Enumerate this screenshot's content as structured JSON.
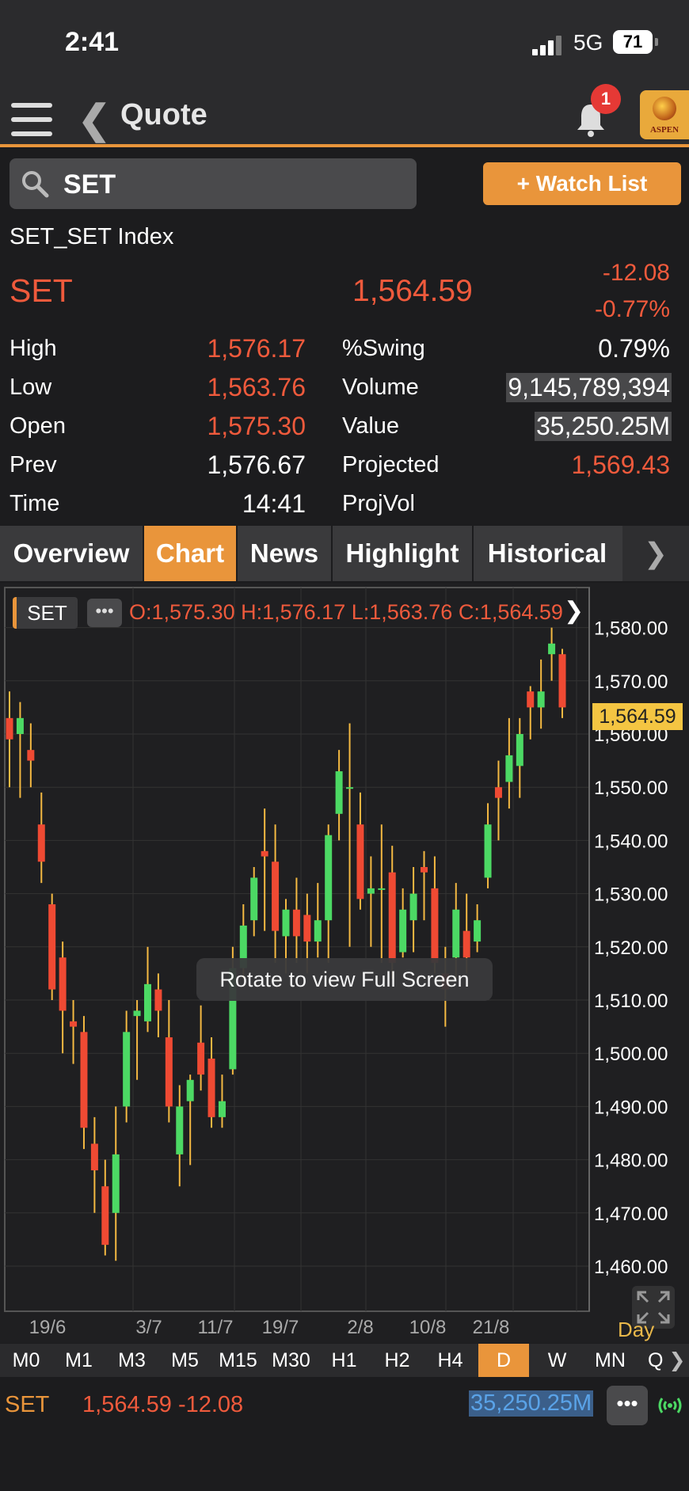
{
  "status": {
    "time": "2:41",
    "network": "5G",
    "battery": "71"
  },
  "header": {
    "title": "Quote",
    "badge": "1",
    "logo_text": "ASPEN"
  },
  "search": {
    "value": "SET",
    "watchlist_label": "+ Watch List"
  },
  "quote": {
    "index_name": "SET_SET Index",
    "symbol": "SET",
    "price": "1,564.59",
    "change": "-12.08",
    "change_pct": "-0.77%"
  },
  "stats": {
    "high_label": "High",
    "high": "1,576.17",
    "low_label": "Low",
    "low": "1,563.76",
    "open_label": "Open",
    "open": "1,575.30",
    "prev_label": "Prev",
    "prev": "1,576.67",
    "time_label": "Time",
    "time": "14:41",
    "swing_label": "%Swing",
    "swing": "0.79%",
    "volume_label": "Volume",
    "volume": "9,145,789,394",
    "value_label": "Value",
    "value": "35,250.25M",
    "projected_label": "Projected",
    "projected": "1,569.43",
    "projvol_label": "ProjVol"
  },
  "tabs": [
    "Overview",
    "Chart",
    "News",
    "Highlight",
    "Historical"
  ],
  "active_tab": "Chart",
  "chart_toolbar": {
    "symbol": "SET",
    "ohlc": "O:1,575.30  H:1,576.17  L:1,563.76  C:1,564.59",
    "rotate_hint": "Rotate to view Full Screen",
    "last_price": "1,564.59",
    "period": "Day"
  },
  "chart_data": {
    "type": "candlestick",
    "y_ticks": [
      "1,580.00",
      "1,570.00",
      "1,560.00",
      "1,550.00",
      "1,540.00",
      "1,530.00",
      "1,520.00",
      "1,510.00",
      "1,500.00",
      "1,490.00",
      "1,480.00",
      "1,470.00",
      "1,460.00"
    ],
    "x_ticks": [
      "19/6",
      "3/7",
      "11/7",
      "19/7",
      "2/8",
      "10/8",
      "21/8"
    ],
    "ylim": [
      1455,
      1587
    ],
    "up_color": "#4cd964",
    "down_color": "#ef4a33",
    "candles": [
      {
        "o": 1563,
        "h": 1568,
        "l": 1550,
        "c": 1559
      },
      {
        "o": 1560,
        "h": 1566,
        "l": 1548,
        "c": 1563
      },
      {
        "o": 1557,
        "h": 1562,
        "l": 1550,
        "c": 1555
      },
      {
        "o": 1543,
        "h": 1549,
        "l": 1532,
        "c": 1536
      },
      {
        "o": 1528,
        "h": 1530,
        "l": 1510,
        "c": 1512
      },
      {
        "o": 1518,
        "h": 1521,
        "l": 1500,
        "c": 1508
      },
      {
        "o": 1506,
        "h": 1510,
        "l": 1498,
        "c": 1505
      },
      {
        "o": 1504,
        "h": 1507,
        "l": 1482,
        "c": 1486
      },
      {
        "o": 1483,
        "h": 1488,
        "l": 1470,
        "c": 1478
      },
      {
        "o": 1475,
        "h": 1480,
        "l": 1462,
        "c": 1464
      },
      {
        "o": 1470,
        "h": 1490,
        "l": 1461,
        "c": 1481
      },
      {
        "o": 1490,
        "h": 1508,
        "l": 1487,
        "c": 1504
      },
      {
        "o": 1507,
        "h": 1510,
        "l": 1495,
        "c": 1508
      },
      {
        "o": 1506,
        "h": 1520,
        "l": 1504,
        "c": 1513
      },
      {
        "o": 1512,
        "h": 1515,
        "l": 1503,
        "c": 1508
      },
      {
        "o": 1503,
        "h": 1510,
        "l": 1487,
        "c": 1490
      },
      {
        "o": 1481,
        "h": 1494,
        "l": 1475,
        "c": 1490
      },
      {
        "o": 1491,
        "h": 1496,
        "l": 1479,
        "c": 1495
      },
      {
        "o": 1502,
        "h": 1509,
        "l": 1493,
        "c": 1496
      },
      {
        "o": 1499,
        "h": 1503,
        "l": 1486,
        "c": 1488
      },
      {
        "o": 1488,
        "h": 1496,
        "l": 1486,
        "c": 1491
      },
      {
        "o": 1497,
        "h": 1520,
        "l": 1496,
        "c": 1516
      },
      {
        "o": 1516,
        "h": 1528,
        "l": 1514,
        "c": 1524
      },
      {
        "o": 1525,
        "h": 1535,
        "l": 1522,
        "c": 1533
      },
      {
        "o": 1538,
        "h": 1546,
        "l": 1523,
        "c": 1537
      },
      {
        "o": 1536,
        "h": 1543,
        "l": 1517,
        "c": 1523
      },
      {
        "o": 1522,
        "h": 1529,
        "l": 1515,
        "c": 1527
      },
      {
        "o": 1527,
        "h": 1533,
        "l": 1517,
        "c": 1522
      },
      {
        "o": 1526,
        "h": 1530,
        "l": 1515,
        "c": 1521
      },
      {
        "o": 1521,
        "h": 1532,
        "l": 1518,
        "c": 1525
      },
      {
        "o": 1525,
        "h": 1543,
        "l": 1517,
        "c": 1541
      },
      {
        "o": 1545,
        "h": 1557,
        "l": 1540,
        "c": 1553
      },
      {
        "o": 1550,
        "h": 1562,
        "l": 1520,
        "c": 1550
      },
      {
        "o": 1543,
        "h": 1549,
        "l": 1527,
        "c": 1529
      },
      {
        "o": 1530,
        "h": 1537,
        "l": 1520,
        "c": 1531
      },
      {
        "o": 1531,
        "h": 1543,
        "l": 1517,
        "c": 1531
      },
      {
        "o": 1534,
        "h": 1539,
        "l": 1514,
        "c": 1517
      },
      {
        "o": 1519,
        "h": 1531,
        "l": 1518,
        "c": 1527
      },
      {
        "o": 1525,
        "h": 1535,
        "l": 1519,
        "c": 1530
      },
      {
        "o": 1535,
        "h": 1538,
        "l": 1525,
        "c": 1534
      },
      {
        "o": 1531,
        "h": 1537,
        "l": 1515,
        "c": 1517
      },
      {
        "o": 1515,
        "h": 1520,
        "l": 1505,
        "c": 1512
      },
      {
        "o": 1518,
        "h": 1532,
        "l": 1514,
        "c": 1527
      },
      {
        "o": 1523,
        "h": 1530,
        "l": 1515,
        "c": 1518
      },
      {
        "o": 1521,
        "h": 1528,
        "l": 1519,
        "c": 1525
      },
      {
        "o": 1533,
        "h": 1547,
        "l": 1531,
        "c": 1543
      },
      {
        "o": 1550,
        "h": 1555,
        "l": 1540,
        "c": 1548
      },
      {
        "o": 1551,
        "h": 1563,
        "l": 1546,
        "c": 1556
      },
      {
        "o": 1554,
        "h": 1563,
        "l": 1548,
        "c": 1560
      },
      {
        "o": 1568,
        "h": 1569,
        "l": 1559,
        "c": 1565
      },
      {
        "o": 1565,
        "h": 1574,
        "l": 1561,
        "c": 1568
      },
      {
        "o": 1575,
        "h": 1580,
        "l": 1570,
        "c": 1577
      },
      {
        "o": 1575,
        "h": 1576,
        "l": 1563,
        "c": 1565
      }
    ]
  },
  "timeframes": [
    "M0",
    "M1",
    "M3",
    "M5",
    "M15",
    "M30",
    "H1",
    "H2",
    "H4",
    "D",
    "W",
    "MN",
    "Q"
  ],
  "active_timeframe": "D",
  "ticker": {
    "symbol": "SET",
    "price_change": "1,564.59 -12.08",
    "value": "35,250.25M"
  },
  "colors": {
    "accent": "#e9953b",
    "down": "#ef5a3c",
    "up": "#4cd964",
    "value_blue": "#5aa3e8"
  }
}
